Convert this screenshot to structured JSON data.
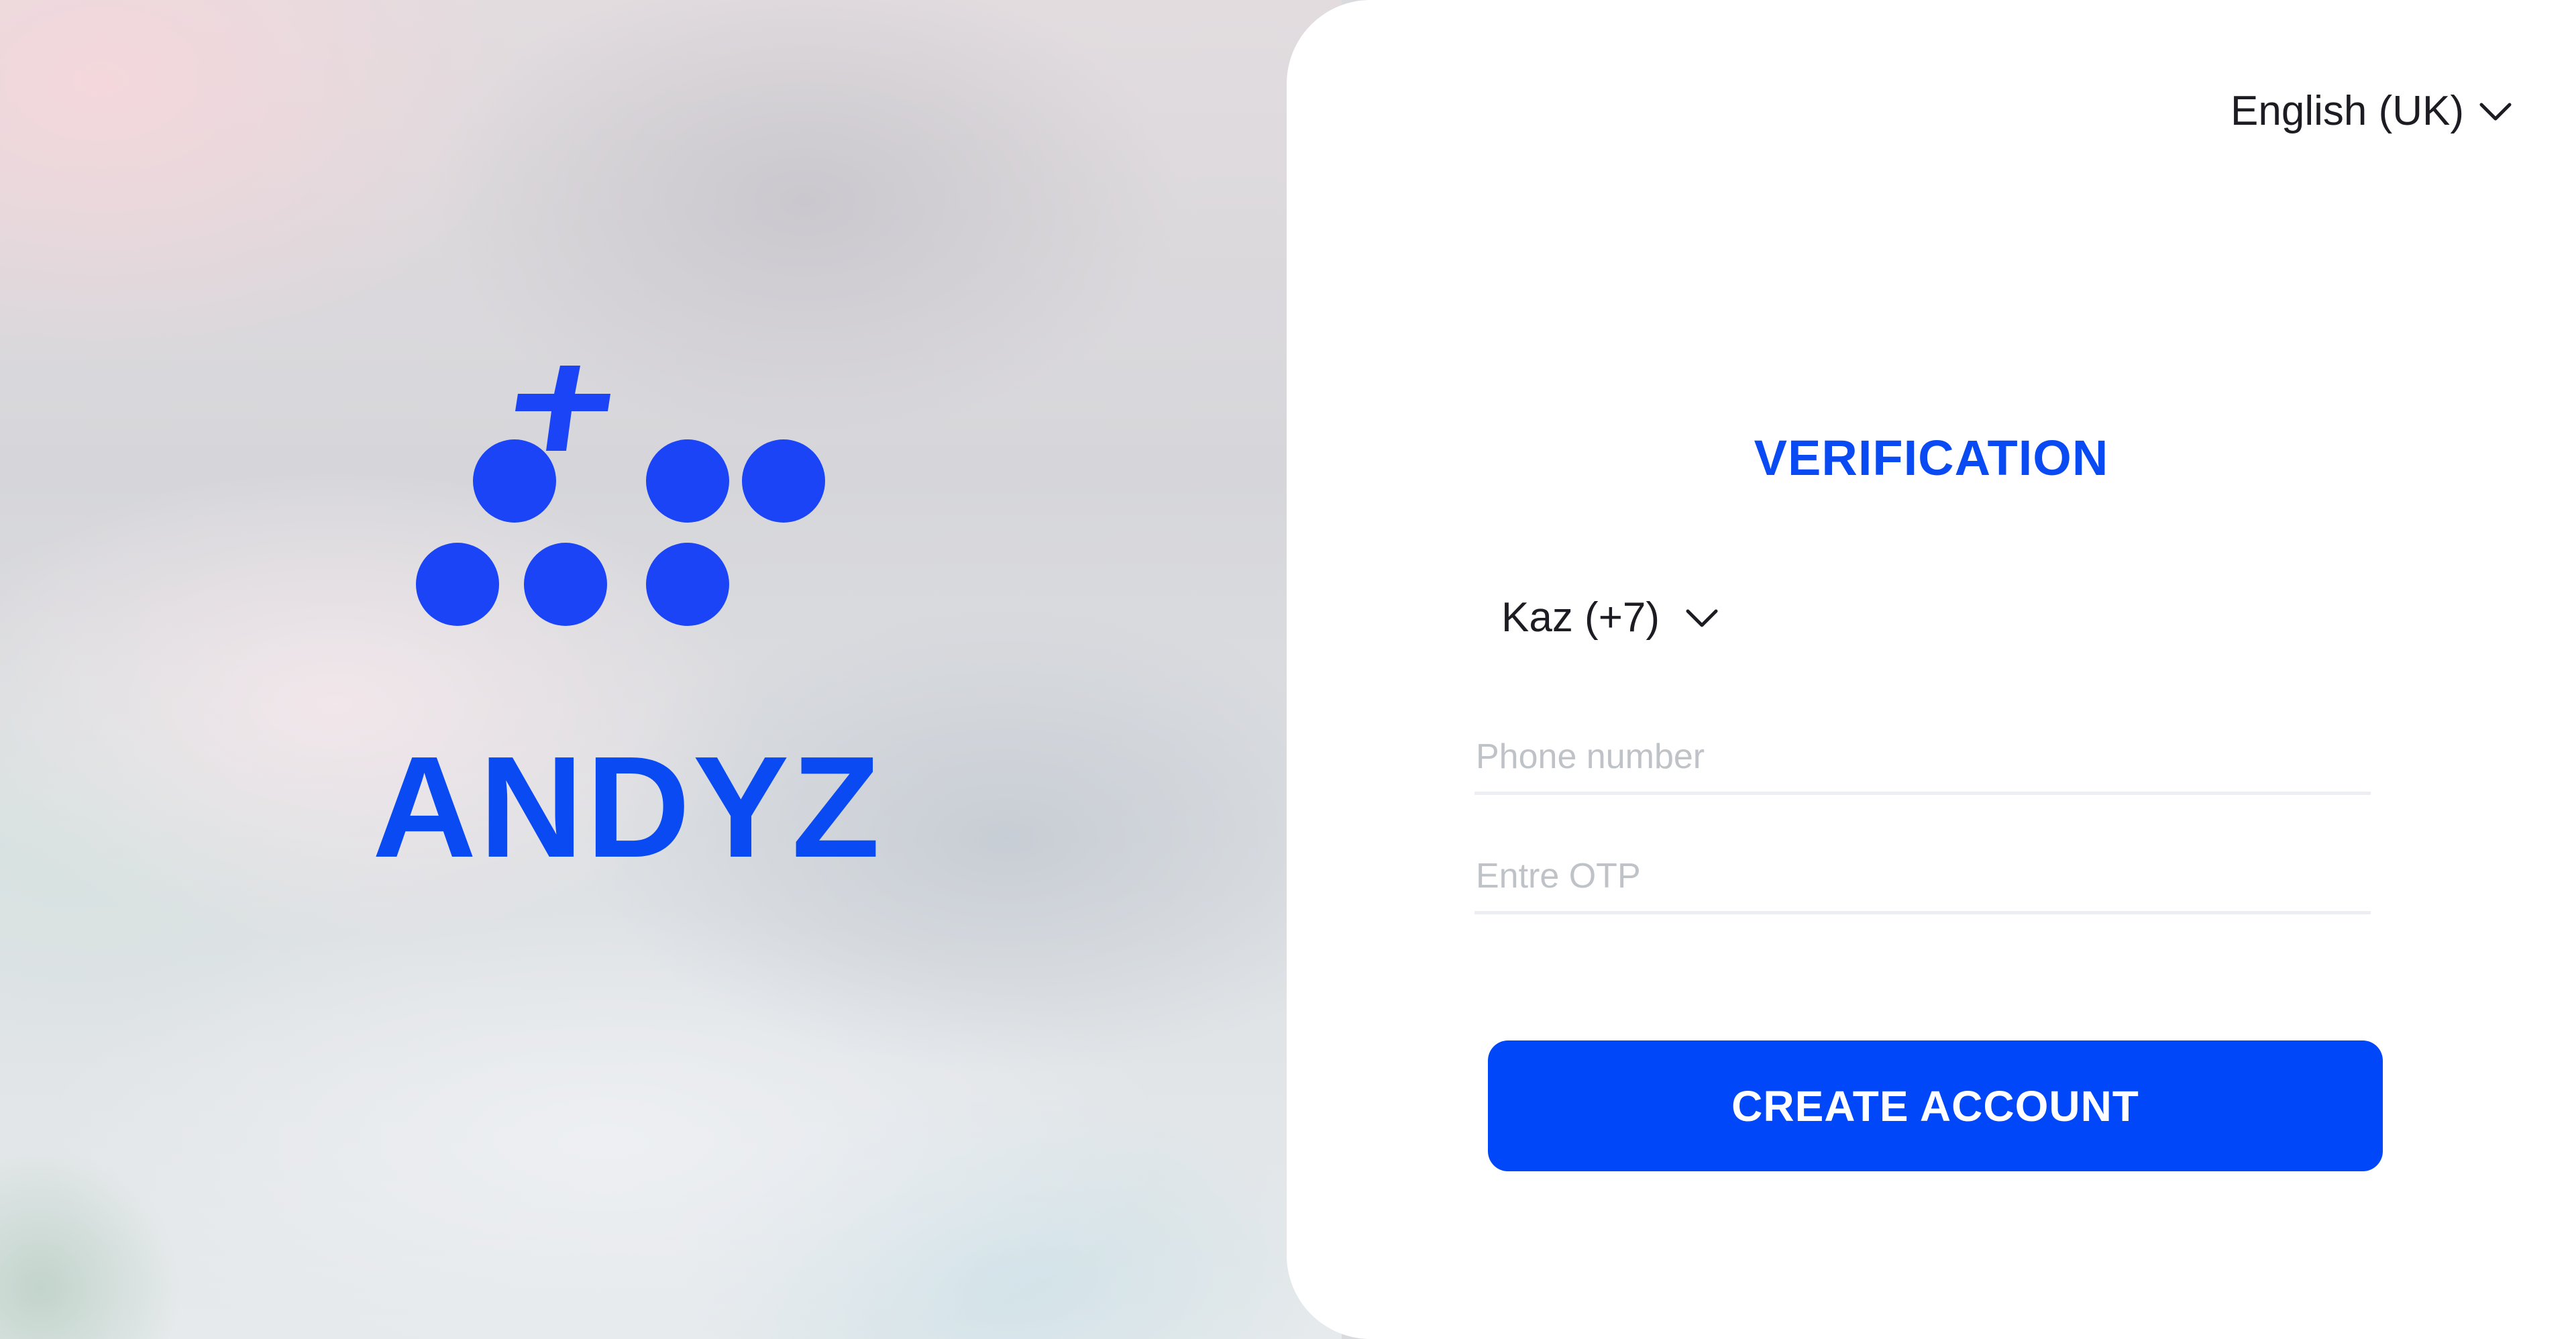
{
  "brand": {
    "name": "ANDYZ",
    "color": "#0a4af2",
    "logo_icon": "plus-dots-logo-icon"
  },
  "language_select": {
    "value": "English (UK)",
    "icon": "chevron-down-icon"
  },
  "form": {
    "title": "VERIFICATION",
    "country_code": {
      "value": "Kaz (+7)",
      "icon": "chevron-down-icon"
    },
    "phone_field": {
      "value": "",
      "placeholder": "Phone number"
    },
    "otp_field": {
      "value": "",
      "placeholder": "Entre OTP"
    },
    "submit_label": "CREATE ACCOUNT",
    "accent_color": "#0047f9"
  }
}
